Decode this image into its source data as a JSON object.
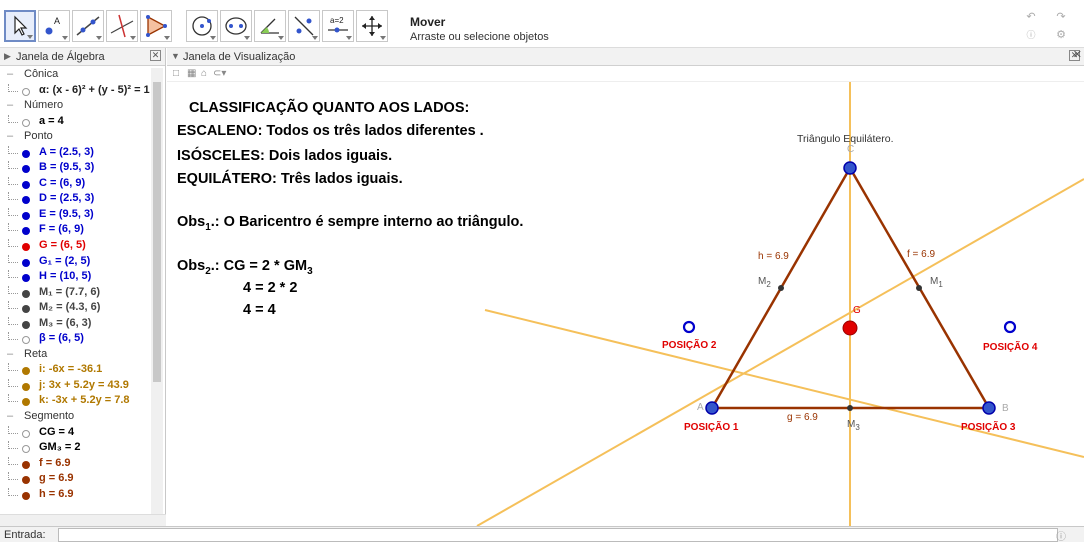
{
  "toolbar": {
    "tools": [
      {
        "name": "move-tool",
        "selected": true
      },
      {
        "name": "point-tool",
        "selected": false
      },
      {
        "name": "line-tool",
        "selected": false
      },
      {
        "name": "perpendicular-line-tool",
        "selected": false
      },
      {
        "name": "polygon-tool",
        "selected": false
      },
      {
        "name": "circle-tool",
        "selected": false
      },
      {
        "name": "conic-tool",
        "selected": false
      },
      {
        "name": "angle-tool",
        "selected": false
      },
      {
        "name": "reflect-tool",
        "selected": false
      },
      {
        "name": "slider-tool",
        "selected": false
      },
      {
        "name": "move-graphics-view-tool",
        "selected": false
      }
    ],
    "slider_icon_text": "a=2",
    "help_title": "Mover",
    "help_description": "Arraste ou selecione objetos"
  },
  "algebra_view": {
    "title": "Janela de Álgebra",
    "rows": [
      {
        "type": "category",
        "text": "Cônica"
      },
      {
        "type": "object",
        "text": "α: (x - 6)² + (y - 5)² = 1",
        "color": "#222222",
        "visible": false
      },
      {
        "type": "category",
        "text": "Número"
      },
      {
        "type": "object",
        "text": "a = 4",
        "color": "#000000",
        "visible": false
      },
      {
        "type": "category",
        "text": "Ponto"
      },
      {
        "type": "object",
        "text": "A = (2.5, 3)",
        "color": "#0000cc",
        "visible": true
      },
      {
        "type": "object",
        "text": "B = (9.5, 3)",
        "color": "#0000cc",
        "visible": true
      },
      {
        "type": "object",
        "text": "C = (6, 9)",
        "color": "#0000cc",
        "visible": true
      },
      {
        "type": "object",
        "text": "D = (2.5, 3)",
        "color": "#0000cc",
        "visible": true
      },
      {
        "type": "object",
        "text": "E = (9.5, 3)",
        "color": "#0000cc",
        "visible": true
      },
      {
        "type": "object",
        "text": "F = (6, 9)",
        "color": "#0000cc",
        "visible": true
      },
      {
        "type": "object",
        "text": "G = (6, 5)",
        "color": "#e00000",
        "visible": true
      },
      {
        "type": "object",
        "text": "G₁ = (2, 5)",
        "color": "#0000cc",
        "visible": true
      },
      {
        "type": "object",
        "text": "H = (10, 5)",
        "color": "#0000cc",
        "visible": true
      },
      {
        "type": "object",
        "text": "M₁ = (7.7, 6)",
        "color": "#444444",
        "visible": true
      },
      {
        "type": "object",
        "text": "M₂ = (4.3, 6)",
        "color": "#444444",
        "visible": true
      },
      {
        "type": "object",
        "text": "M₃ = (6, 3)",
        "color": "#444444",
        "visible": true
      },
      {
        "type": "object",
        "text": "β = (6, 5)",
        "color": "#0000cc",
        "visible": false
      },
      {
        "type": "category",
        "text": "Reta"
      },
      {
        "type": "object",
        "text": "i: -6x = -36.1",
        "color": "#b07800",
        "visible": true
      },
      {
        "type": "object",
        "text": "j: 3x + 5.2y = 43.9",
        "color": "#b07800",
        "visible": true
      },
      {
        "type": "object",
        "text": "k: -3x + 5.2y = 7.8",
        "color": "#b07800",
        "visible": true
      },
      {
        "type": "category",
        "text": "Segmento"
      },
      {
        "type": "object",
        "text": "CG = 4",
        "color": "#000000",
        "visible": false
      },
      {
        "type": "object",
        "text": "GM₃ = 2",
        "color": "#000000",
        "visible": false
      },
      {
        "type": "object",
        "text": "f = 6.9",
        "color": "#993300",
        "visible": true
      },
      {
        "type": "object",
        "text": "g = 6.9",
        "color": "#993300",
        "visible": true
      },
      {
        "type": "object",
        "text": "h = 6.9",
        "color": "#993300",
        "visible": true
      }
    ]
  },
  "graphics_view": {
    "title": "Janela de Visualização",
    "texts": {
      "heading": "CLASSIFICAÇÃO QUANTO AOS LADOS:",
      "scalene": "ESCALENO: Todos os três lados diferentes .",
      "isosceles": "ISÓSCELES: Dois lados iguais.",
      "equilateral": "EQUILÁTERO: Três lados iguais.",
      "obs1_prefix": "Obs",
      "obs1_sub": "1",
      "obs1_suffix": ".: O Baricentro é sempre interno ao triângulo.",
      "obs2_prefix": "Obs",
      "obs2_sub": "2",
      "obs2_mid": ".: CG = 2 * GM",
      "obs2_sub2": "3",
      "eq2": "4 = 2 * 2",
      "eq3": "4 = 4",
      "triangle_caption": "Triângulo Equilátero."
    },
    "labels": {
      "A": "A",
      "B": "B",
      "C": "C",
      "G": "G",
      "M1": "M",
      "M1_sub": "1",
      "M2": "M",
      "M2_sub": "2",
      "M3": "M",
      "M3_sub": "3",
      "f": "f = 6.9",
      "g": "g = 6.9",
      "h": "h = 6.9"
    },
    "positions": {
      "p1": "POSIÇÃO 1",
      "p2": "POSIÇÃO 2",
      "p3": "POSIÇÃO 3",
      "p4": "POSIÇÃO 4"
    },
    "colors": {
      "segment": "#993300",
      "line": "#f5c05a",
      "point": "#0000cc",
      "barycenter": "#e00000",
      "position_text": "#e00000"
    }
  },
  "input_bar": {
    "label": "Entrada:",
    "value": ""
  }
}
